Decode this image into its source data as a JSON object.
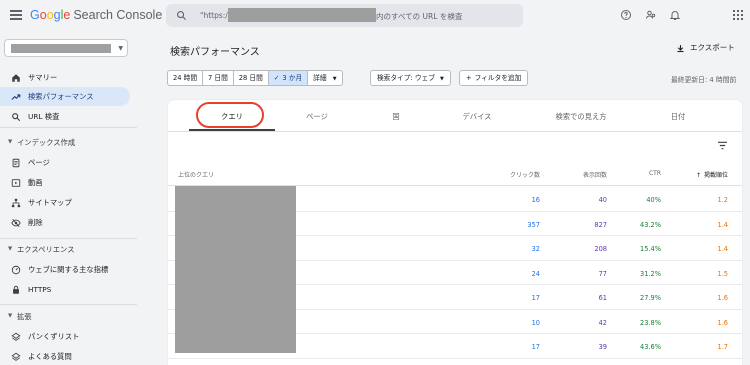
{
  "app": {
    "logo_google": "Google",
    "logo_product": "Search Console"
  },
  "search": {
    "prefix": "\"https://",
    "suffix": "内のすべての URL を検査"
  },
  "header_icons": [
    "help-icon",
    "people-icon",
    "bell-icon",
    "apps-icon"
  ],
  "sidebar": {
    "items": [
      {
        "label": "サマリー",
        "icon": "home-icon"
      },
      {
        "label": "検索パフォーマンス",
        "icon": "trending-icon",
        "active": true
      },
      {
        "label": "URL 検査",
        "icon": "search-icon"
      }
    ],
    "sections": [
      {
        "title": "インデックス作成",
        "items": [
          {
            "label": "ページ",
            "icon": "page-icon"
          },
          {
            "label": "動画",
            "icon": "video-icon"
          },
          {
            "label": "サイトマップ",
            "icon": "sitemap-icon"
          },
          {
            "label": "削除",
            "icon": "eye-off-icon"
          }
        ]
      },
      {
        "title": "エクスペリエンス",
        "items": [
          {
            "label": "ウェブに関する主な指標",
            "icon": "gauge-icon"
          },
          {
            "label": "HTTPS",
            "icon": "lock-icon"
          }
        ]
      },
      {
        "title": "拡張",
        "items": [
          {
            "label": "パンくずリスト",
            "icon": "layers-icon"
          },
          {
            "label": "よくある質問",
            "icon": "layers-icon"
          }
        ]
      }
    ]
  },
  "main": {
    "title": "検索パフォーマンス",
    "export_label": "エクスポート",
    "date_chips": [
      "24 時間",
      "7 日間",
      "28 日間",
      "3 か月"
    ],
    "selected_chip": "3 か月",
    "detail_label": "詳細",
    "search_type_label": "検索タイプ: ウェブ",
    "add_filter_label": "フィルタを追加",
    "last_updated": "最終更新日: 4 時間前",
    "tabs": [
      "クエリ",
      "ページ",
      "国",
      "デバイス",
      "検索での見え方",
      "日付"
    ],
    "active_tab": "クエリ"
  },
  "table": {
    "headers": {
      "query": "上位のクエリ",
      "clicks": "クリック数",
      "impressions": "表示回数",
      "ctr": "CTR",
      "position": "掲載順位"
    },
    "rows": [
      {
        "clicks": "16",
        "impressions": "40",
        "ctr": "40%",
        "position": "1.2"
      },
      {
        "clicks": "357",
        "impressions": "827",
        "ctr": "43.2%",
        "position": "1.4"
      },
      {
        "clicks": "32",
        "impressions": "208",
        "ctr": "15.4%",
        "position": "1.4"
      },
      {
        "clicks": "24",
        "impressions": "77",
        "ctr": "31.2%",
        "position": "1.5"
      },
      {
        "clicks": "17",
        "impressions": "61",
        "ctr": "27.9%",
        "position": "1.6"
      },
      {
        "clicks": "10",
        "impressions": "42",
        "ctr": "23.8%",
        "position": "1.6"
      },
      {
        "clicks": "17",
        "impressions": "39",
        "ctr": "43.6%",
        "position": "1.7"
      }
    ]
  },
  "colors": {
    "clicks": "#1a73e8",
    "impressions": "#5e35b1",
    "ctr": "#188038",
    "position": "#e8710a",
    "annotation": "#e8402f"
  }
}
